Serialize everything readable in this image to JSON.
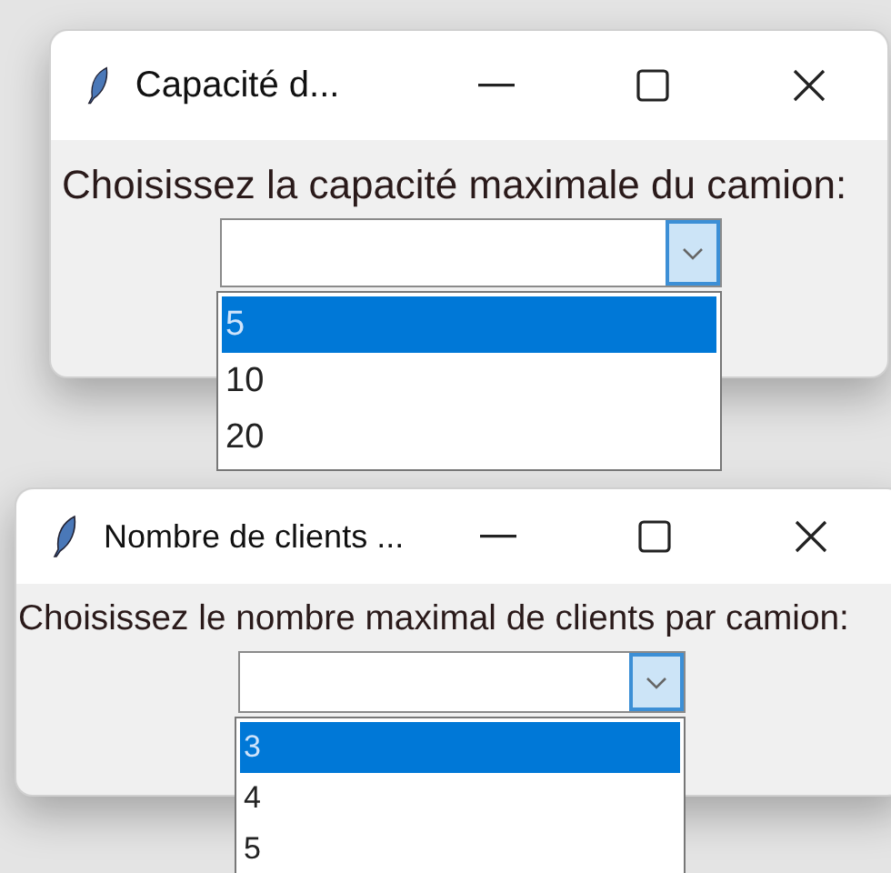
{
  "windows": [
    {
      "title": "Capacité d...",
      "prompt": "Choisissez la capacité maximale du camion:",
      "options": [
        {
          "label": "5",
          "selected": true
        },
        {
          "label": "10",
          "selected": false
        },
        {
          "label": "20",
          "selected": false
        }
      ]
    },
    {
      "title": "Nombre de clients ...",
      "prompt": "Choisissez le nombre maximal de clients par camion:",
      "options": [
        {
          "label": "3",
          "selected": true
        },
        {
          "label": "4",
          "selected": false
        },
        {
          "label": "5",
          "selected": false
        }
      ]
    }
  ]
}
